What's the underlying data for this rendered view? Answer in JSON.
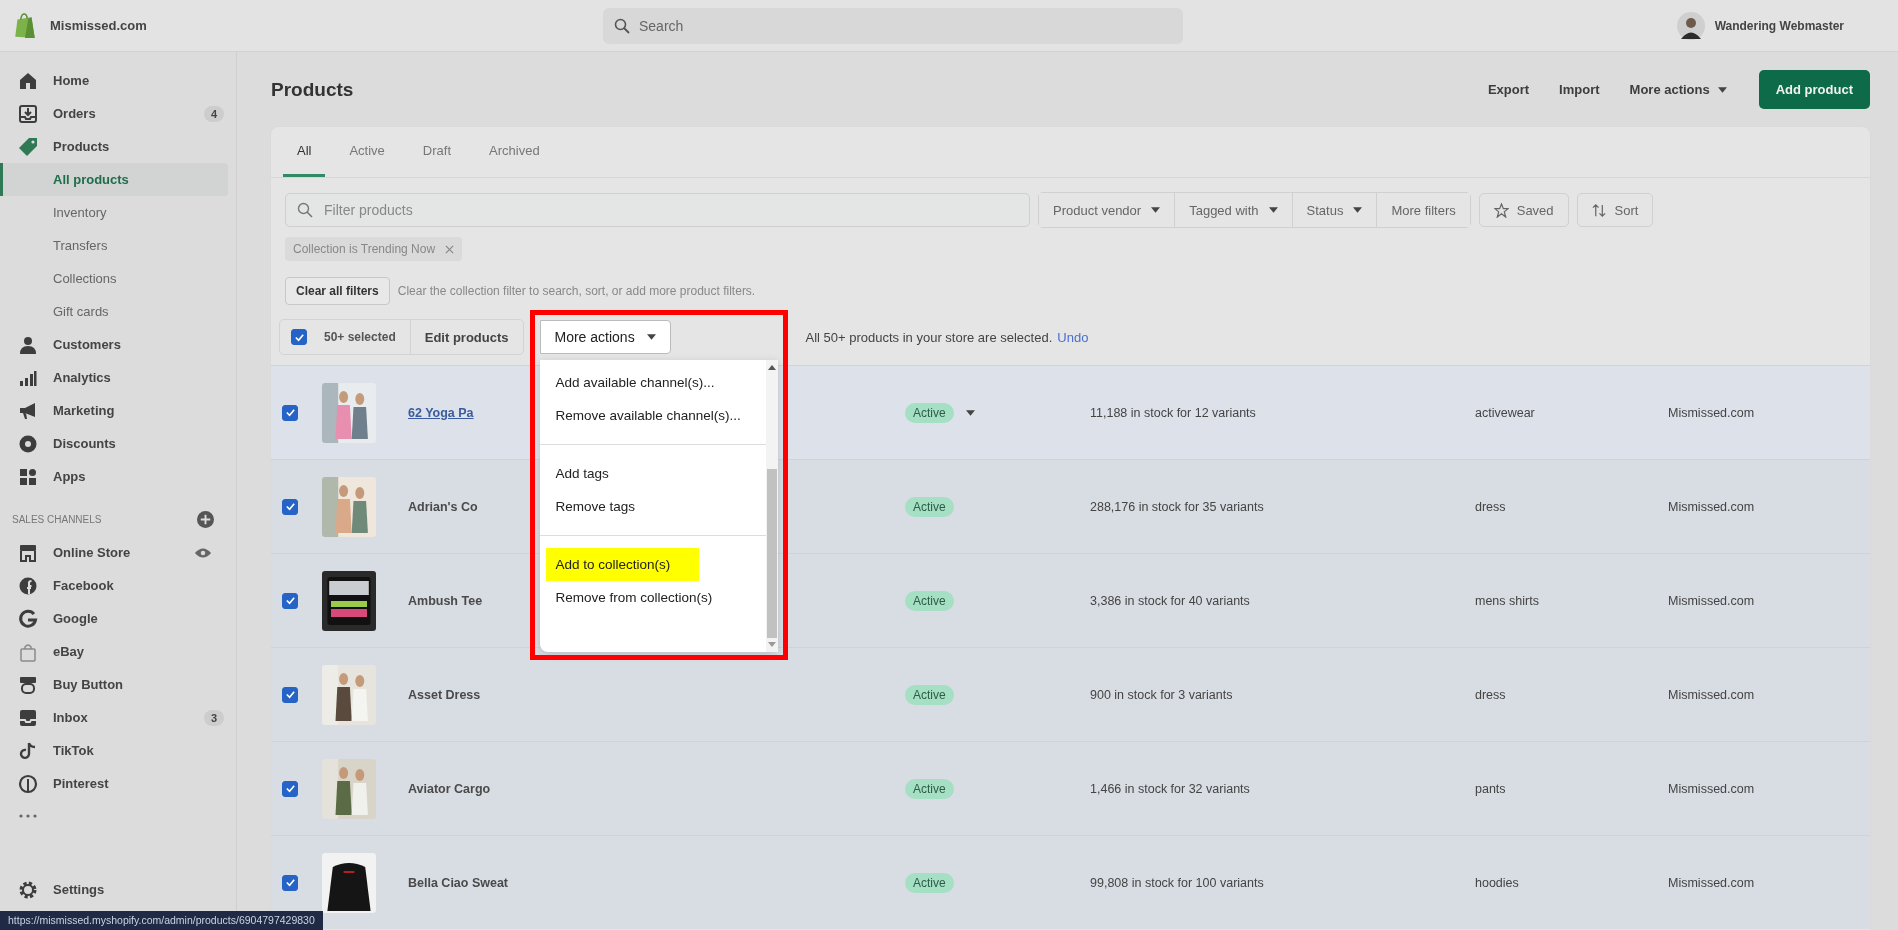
{
  "topbar": {
    "store_name": "Mismissed.com",
    "search": {
      "placeholder": "Search"
    },
    "user_name": "Wandering Webmaster"
  },
  "sidebar": {
    "items": [
      {
        "label": "Home",
        "selected": false
      },
      {
        "label": "Orders",
        "selected": false,
        "badge": "4"
      },
      {
        "label": "Products",
        "selected": false,
        "expanded": true,
        "children": [
          {
            "label": "All products",
            "selected": true
          },
          {
            "label": "Inventory",
            "selected": false
          },
          {
            "label": "Transfers",
            "selected": false
          },
          {
            "label": "Collections",
            "selected": false
          },
          {
            "label": "Gift cards",
            "selected": false
          }
        ]
      },
      {
        "label": "Customers",
        "selected": false
      },
      {
        "label": "Analytics",
        "selected": false
      },
      {
        "label": "Marketing",
        "selected": false
      },
      {
        "label": "Discounts",
        "selected": false
      },
      {
        "label": "Apps",
        "selected": false
      }
    ],
    "channels_title": "SALES CHANNELS",
    "channels": [
      {
        "label": "Online Store"
      },
      {
        "label": "Facebook"
      },
      {
        "label": "Google"
      },
      {
        "label": "eBay"
      },
      {
        "label": "Buy Button"
      },
      {
        "label": "Inbox",
        "badge": "3"
      },
      {
        "label": "TikTok"
      },
      {
        "label": "Pinterest"
      }
    ],
    "settings": "Settings"
  },
  "page": {
    "title": "Products",
    "actions": [
      "Export",
      "Import"
    ],
    "more_actions": "More actions",
    "primary_action": "Add product"
  },
  "tabs": [
    {
      "label": "All",
      "selected": true
    },
    {
      "label": "Active",
      "selected": false
    },
    {
      "label": "Draft",
      "selected": false
    },
    {
      "label": "Archived",
      "selected": false
    }
  ],
  "filters": {
    "search_placeholder": "Filter products",
    "dropdowns": [
      {
        "label": "Product vendor",
        "kind": "dropdown"
      },
      {
        "label": "Tagged with",
        "kind": "dropdown"
      },
      {
        "label": "Status",
        "kind": "dropdown"
      },
      {
        "label": "More filters",
        "kind": "plain"
      }
    ],
    "saved": "Saved",
    "sort": "Sort",
    "chips": [
      "Collection is Trending Now"
    ],
    "clear_button": "Clear all filters",
    "hint": "Clear the collection filter to search, sort, or add more product filters."
  },
  "bulk_bar": {
    "checked": true,
    "count": "50+ selected",
    "edit": "Edit products",
    "more": "More actions",
    "message": "All 50+ products in your store are selected.",
    "undo": "Undo"
  },
  "menu": {
    "sections": [
      [
        {
          "label": "Add available channel(s)...",
          "highlighted": false
        },
        {
          "label": "Remove available channel(s)...",
          "highlighted": false
        }
      ],
      [
        {
          "label": "Add tags",
          "highlighted": false
        },
        {
          "label": "Remove tags",
          "highlighted": false
        }
      ],
      [
        {
          "label": "Add to collection(s)",
          "highlighted": true
        },
        {
          "label": "Remove from collection(s)",
          "highlighted": false
        }
      ]
    ]
  },
  "rows": [
    {
      "checked": true,
      "hovered": true,
      "name": "62 Yoga Pa",
      "status": "Active",
      "inventory": "11,188 in stock for 12 variants",
      "product_type": "activewear",
      "vendor": "Mismissed.com"
    },
    {
      "checked": true,
      "hovered": false,
      "name": "Adrian's Co",
      "status": "Active",
      "inventory": "288,176 in stock for 35 variants",
      "product_type": "dress",
      "vendor": "Mismissed.com"
    },
    {
      "checked": true,
      "hovered": false,
      "name": "Ambush Tee",
      "status": "Active",
      "inventory": "3,386 in stock for 40 variants",
      "product_type": "mens shirts",
      "vendor": "Mismissed.com"
    },
    {
      "checked": true,
      "hovered": false,
      "name": "Asset Dress",
      "status": "Active",
      "inventory": "900 in stock for 3 variants",
      "product_type": "dress",
      "vendor": "Mismissed.com"
    },
    {
      "checked": true,
      "hovered": false,
      "name": "Aviator Cargo",
      "status": "Active",
      "inventory": "1,466 in stock for 32 variants",
      "product_type": "pants",
      "vendor": "Mismissed.com"
    },
    {
      "checked": true,
      "hovered": false,
      "name": "Bella Ciao Sweat",
      "status": "Active",
      "inventory": "99,808 in stock for 100 variants",
      "product_type": "hoodies",
      "vendor": "Mismissed.com"
    }
  ],
  "status_url": "https://mismissed.myshopify.com/admin/products/6904797429830"
}
